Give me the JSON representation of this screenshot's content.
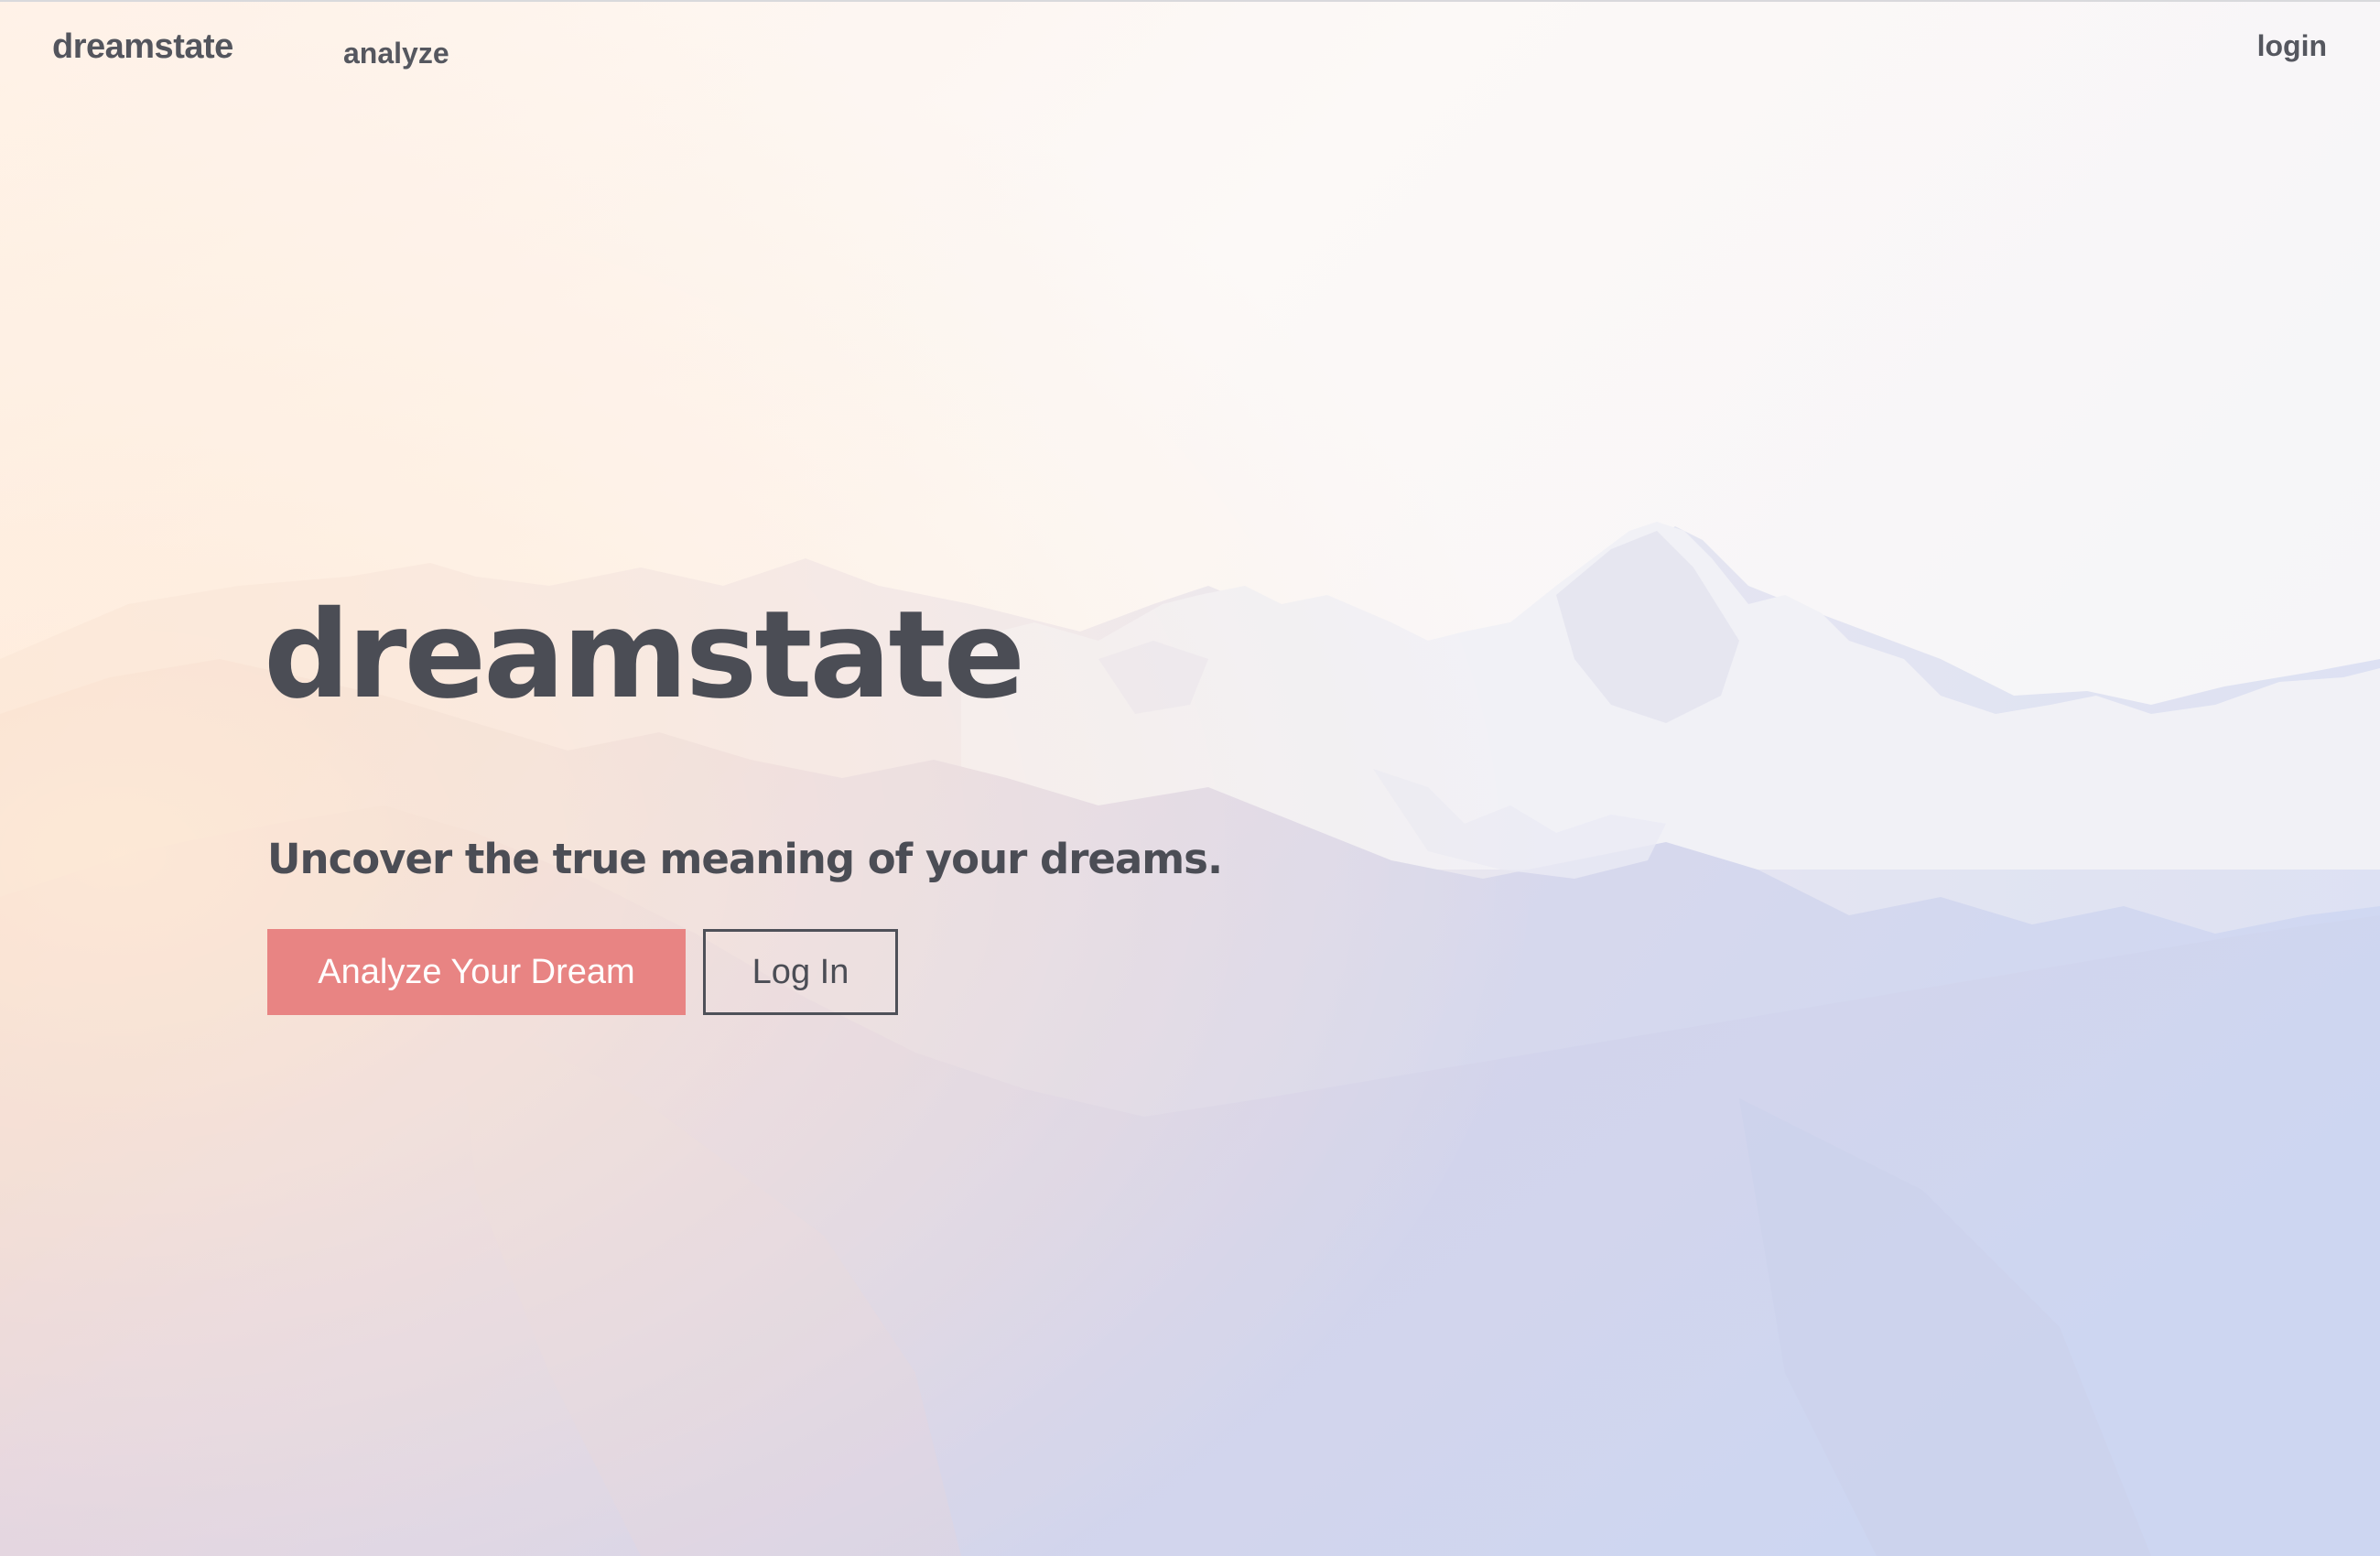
{
  "nav": {
    "brand": "dreamstate",
    "analyze_link": "analyze",
    "login_link": "login"
  },
  "hero": {
    "title": "dreamstate",
    "tagline": "Uncover the true meaning of your dreams.",
    "primary_button": "Analyze Your Dream",
    "secondary_button": "Log In"
  },
  "colors": {
    "primary_button": "#e88483",
    "text": "#4b4d55",
    "background_top": "#fbf6f3",
    "mountain_tint": "#c9cbe8"
  }
}
